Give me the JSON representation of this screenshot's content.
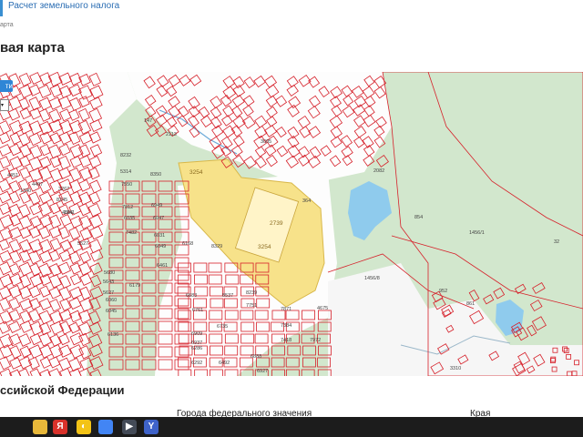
{
  "header": {
    "tool_link": "Расчет земельного налога"
  },
  "breadcrumb": "арта",
  "page_title": "вая карта",
  "map": {
    "button_label": "ти",
    "select_value": "",
    "highlight_color": "#f7e28a",
    "parcel_color": "#d6202a",
    "forest_color": "#d2e7cd",
    "water_color": "#8fcbed",
    "labels": [
      "3254",
      "2739",
      "3254",
      "7550",
      "4806",
      "5314",
      "8350",
      "8232",
      "6949",
      "6047",
      "6035",
      "7812",
      "7482",
      "6031",
      "6049",
      "6168",
      "8329",
      "6461",
      "6179",
      "6683",
      "6761",
      "6735",
      "7871",
      "4675",
      "7384",
      "7418",
      "7972",
      "8239",
      "7751",
      "8537",
      "6292",
      "6286",
      "6492",
      "6888",
      "6927",
      "6909",
      "6937",
      "6060",
      "6045",
      "6136",
      "5680",
      "5643",
      "5627",
      "2113",
      "147",
      "2082",
      "854",
      "1456/1",
      "32",
      "1456/8",
      "952",
      "861",
      "3310",
      "3005",
      "364",
      "1341",
      "1340",
      "4451",
      "4497",
      "3267",
      "8245",
      "5527"
    ]
  },
  "section_title": "ссийской Федерации",
  "columns": [
    "Города федерального значения",
    "Края"
  ],
  "taskbar": {
    "items": [
      {
        "name": "explorer-icon",
        "glyph": "",
        "color": "#e8b83a"
      },
      {
        "name": "yandex-icon",
        "glyph": "Я",
        "color": "#d9322b"
      },
      {
        "name": "app-icon",
        "glyph": "◐",
        "color": "#f3c316"
      },
      {
        "name": "chrome-icon",
        "glyph": "",
        "color": "#4285f4"
      },
      {
        "name": "media-icon",
        "glyph": "▶",
        "color": "#444b57"
      },
      {
        "name": "yandex-browser-icon",
        "glyph": "Y",
        "color": "#3f63c9"
      }
    ]
  }
}
